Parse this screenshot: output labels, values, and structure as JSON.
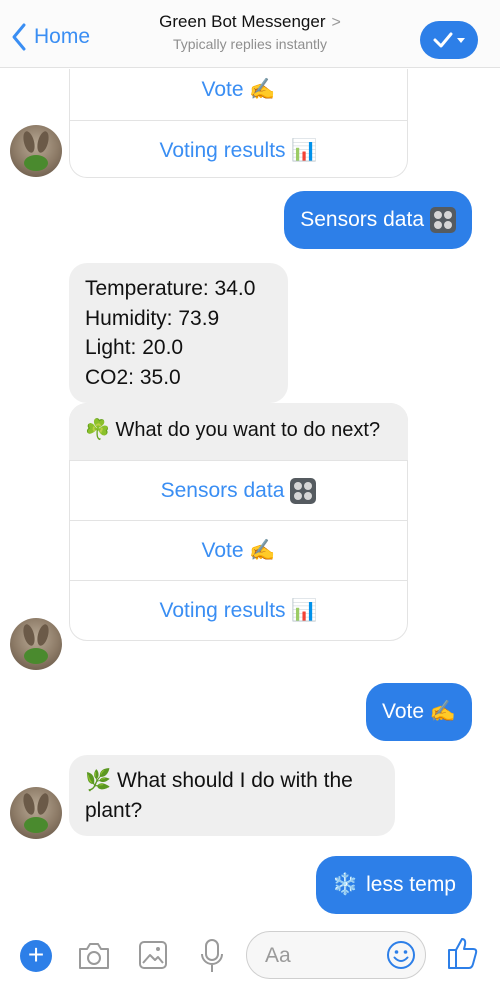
{
  "header": {
    "back_label": "Home",
    "title": "Green Bot Messenger",
    "title_chevron": ">",
    "subtitle": "Typically replies instantly"
  },
  "messages": {
    "card1": {
      "options": [
        "Vote ✍️",
        "Voting results 📊"
      ]
    },
    "out1": {
      "text": "Sensors data"
    },
    "sensor_reply": {
      "lines": [
        "Temperature: 34.0",
        "Humidity: 73.9",
        "Light: 20.0",
        "CO2: 35.0"
      ]
    },
    "card2": {
      "question_emoji": "☘️",
      "question": "What do you want to do next?",
      "options": [
        "Sensors data",
        "Vote ✍️",
        "Voting results 📊"
      ]
    },
    "out2": {
      "text": "Vote ✍️"
    },
    "plant_question": {
      "emoji": "🌿",
      "text": "What should I do with the plant?"
    },
    "out3": {
      "emoji": "❄️",
      "text": "less temp"
    }
  },
  "composer": {
    "placeholder": "Aa"
  },
  "colors": {
    "accent": "#2d7fe8",
    "link": "#3a8ef3",
    "incoming_bubble": "#efefef"
  }
}
